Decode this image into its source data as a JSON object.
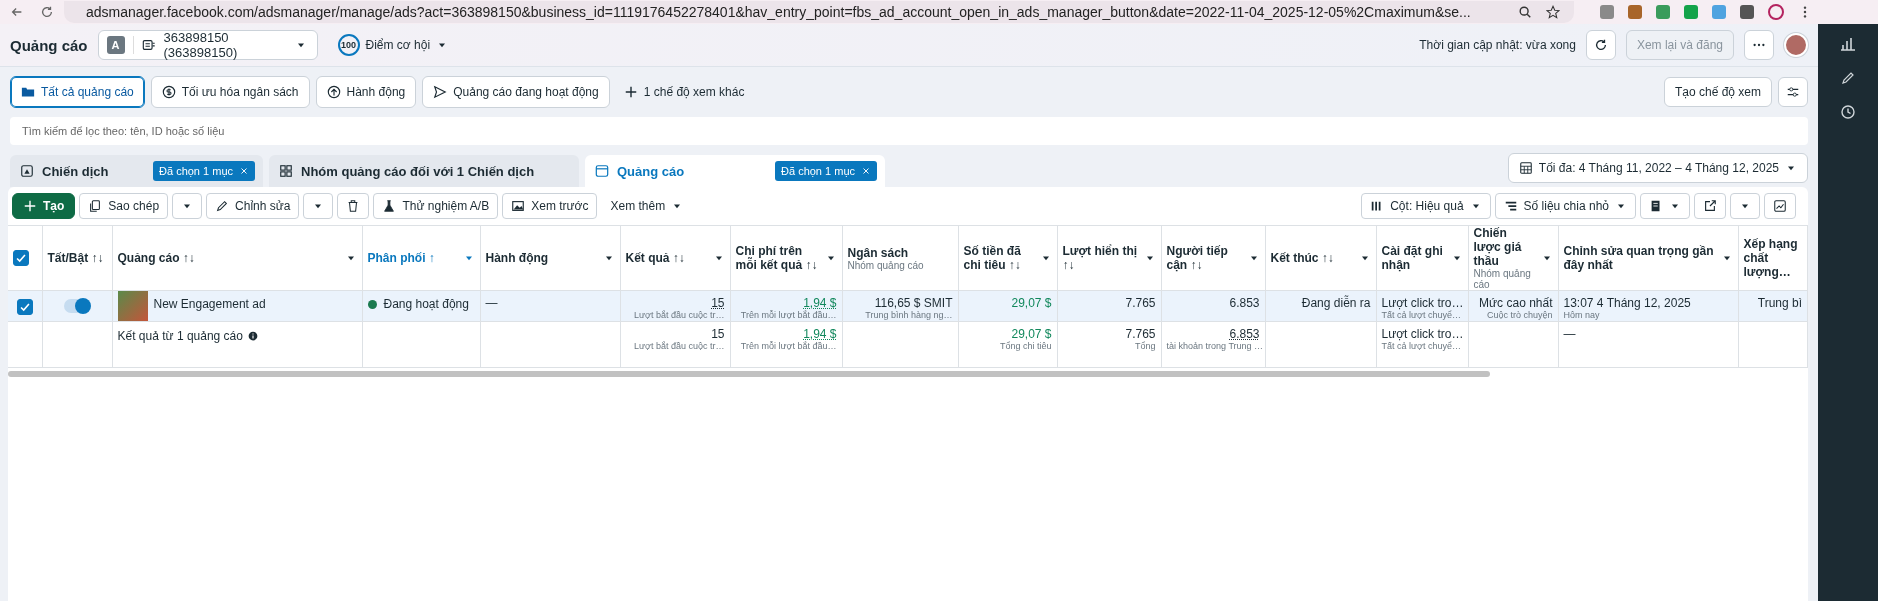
{
  "browser": {
    "url": "adsmanager.facebook.com/adsmanager/manage/ads?act=363898150&business_id=1119176452278401&hav_entry_point=fbs_ad_account_open_in_ads_manager_button&date=2022-11-04_2025-12-05%2Cmaximum&se..."
  },
  "header": {
    "title": "Quảng cáo",
    "account_badge": "A",
    "account": "363898150 (363898150)",
    "score": "100",
    "score_label": "Điểm cơ hội",
    "updated": "Thời gian cập nhật: vừa xong",
    "review_button": {
      "label": "Xem lại và đăng",
      "disabled": true
    }
  },
  "views": [
    {
      "label": "Tất cả quảng cáo",
      "selected": true
    },
    {
      "label": "Tối ưu hóa ngân sách",
      "selected": false
    },
    {
      "label": "Hành động",
      "selected": false
    },
    {
      "label": "Quảng cáo đang hoạt động",
      "selected": false
    }
  ],
  "more_views": "1 chế độ xem khác",
  "create_view": "Tạo chế độ xem",
  "search": {
    "placeholder": "Tìm kiếm để lọc theo: tên, ID hoặc số liệu"
  },
  "levels": [
    {
      "label": "Chiến dịch",
      "chip": "Đã chọn 1 mục",
      "selected": false
    },
    {
      "label": "Nhóm quảng cáo đối với 1 Chiến dịch",
      "selected": false
    },
    {
      "label": "Quảng cáo",
      "chip": "Đã chọn 1 mục",
      "selected": true
    }
  ],
  "date_range": "Tối đa: 4 Tháng 11, 2022 – 4 Tháng 12, 2025",
  "toolbar": {
    "create": "Tạo",
    "copy": "Sao chép",
    "edit": "Chỉnh sửa",
    "ab_test": "Thử nghiệm A/B",
    "preview": "Xem trước",
    "more": "Xem thêm",
    "columns": "Cột: Hiệu quả",
    "breakdown": "Số liệu chia nhỏ"
  },
  "table": {
    "header_checked": true,
    "columns": [
      {
        "label": "Tất/Bật ↑↓",
        "menu": false,
        "sorted": false
      },
      {
        "label": "Quảng cáo ↑↓",
        "menu": true,
        "sorted": false
      },
      {
        "label": "Phân phối ↑",
        "menu": true,
        "sorted": true
      },
      {
        "label": "Hành động",
        "menu": true,
        "sorted": false
      },
      {
        "label": "Kết quả ↑↓",
        "menu": true,
        "sorted": false
      },
      {
        "label": "Chi phí trên mỗi kết quả ↑↓",
        "menu": true,
        "sorted": false
      },
      {
        "label": "Ngân sách",
        "sub": "Nhóm quảng cáo",
        "menu": false,
        "sorted": false
      },
      {
        "label": "Số tiền đã chi tiêu ↑↓",
        "menu": true,
        "sorted": false
      },
      {
        "label": "Lượt hiển thị ↑↓",
        "menu": true,
        "sorted": false
      },
      {
        "label": "Người tiếp cận ↑↓",
        "menu": true,
        "sorted": false
      },
      {
        "label": "Kết thúc ↑↓",
        "menu": true,
        "sorted": false
      },
      {
        "label": "Cài đặt ghi nhận",
        "menu": true,
        "sorted": false
      },
      {
        "label": "Chiến lược giá thầu",
        "sub": "Nhóm quảng cáo",
        "menu": true,
        "sorted": false
      },
      {
        "label": "Chỉnh sửa quan trọng gần đây nhất",
        "menu": true,
        "sorted": false
      },
      {
        "label": "Xếp hạng chất lượng…",
        "menu": false,
        "sorted": false
      }
    ],
    "rows": [
      {
        "kind": "ad",
        "selected": true,
        "checked": true,
        "cells": [
          {
            "kind": "toggle",
            "on": true
          },
          {
            "kind": "ad",
            "text": "New Engagement ad"
          },
          {
            "kind": "status",
            "text": "Đang hoạt động",
            "color": "#1b7a4f"
          },
          {
            "kind": "text",
            "text": "—"
          },
          {
            "kind": "number",
            "text": "15",
            "sub": "Lượt bắt đầu cuộc tr…",
            "money": false,
            "underlined": true
          },
          {
            "kind": "number",
            "text": "1,94 $",
            "sub": "Trên mỗi lượt bắt đầu…",
            "money": true,
            "underlined": true
          },
          {
            "kind": "number",
            "text": "116,65 $ SMIT",
            "sub": "Trung bình hàng ng…",
            "money": false,
            "underlined": false
          },
          {
            "kind": "number",
            "text": "29,07 $",
            "money": true,
            "underlined": false
          },
          {
            "kind": "number",
            "text": "7.765",
            "money": false,
            "underlined": false
          },
          {
            "kind": "number",
            "text": "6.853",
            "money": false,
            "underlined": false
          },
          {
            "kind": "number",
            "text": "Đang diễn ra",
            "money": false,
            "underlined": false
          },
          {
            "kind": "text",
            "text": "Lượt click tro…",
            "sub": "Tất cả lượt chuyể…"
          },
          {
            "kind": "number",
            "text": "Mức cao nhất",
            "sub": "Cuộc trò chuyện",
            "money": false,
            "underlined": false
          },
          {
            "kind": "text",
            "text": "13:07 4 Tháng 12, 2025",
            "sub": "Hôm nay"
          },
          {
            "kind": "number",
            "text": "Trung bì",
            "money": false,
            "underlined": false
          }
        ]
      },
      {
        "kind": "summary",
        "selected": false,
        "cells": [
          {
            "kind": "empty"
          },
          {
            "kind": "summary",
            "text": "Kết quả từ 1 quảng cáo"
          },
          {
            "kind": "empty"
          },
          {
            "kind": "empty"
          },
          {
            "kind": "number",
            "text": "15",
            "sub": "Lượt bắt đầu cuộc tr…",
            "money": false,
            "underlined": false
          },
          {
            "kind": "number",
            "text": "1,94 $",
            "sub": "Trên mỗi lượt bắt đầu…",
            "money": true,
            "underlined": true
          },
          {
            "kind": "empty"
          },
          {
            "kind": "number",
            "text": "29,07 $",
            "sub": "Tổng chi tiêu",
            "money": true,
            "underlined": false
          },
          {
            "kind": "number",
            "text": "7.765",
            "sub": "Tổng",
            "money": false,
            "underlined": false
          },
          {
            "kind": "number",
            "text": "6.853",
            "sub": "tài khoản trong Trung …",
            "money": false,
            "underlined": true
          },
          {
            "kind": "empty"
          },
          {
            "kind": "text",
            "text": "Lượt click tro…",
            "sub": "Tất cả lượt chuyể…"
          },
          {
            "kind": "empty"
          },
          {
            "kind": "text",
            "text": "—"
          },
          {
            "kind": "empty"
          }
        ]
      }
    ]
  }
}
